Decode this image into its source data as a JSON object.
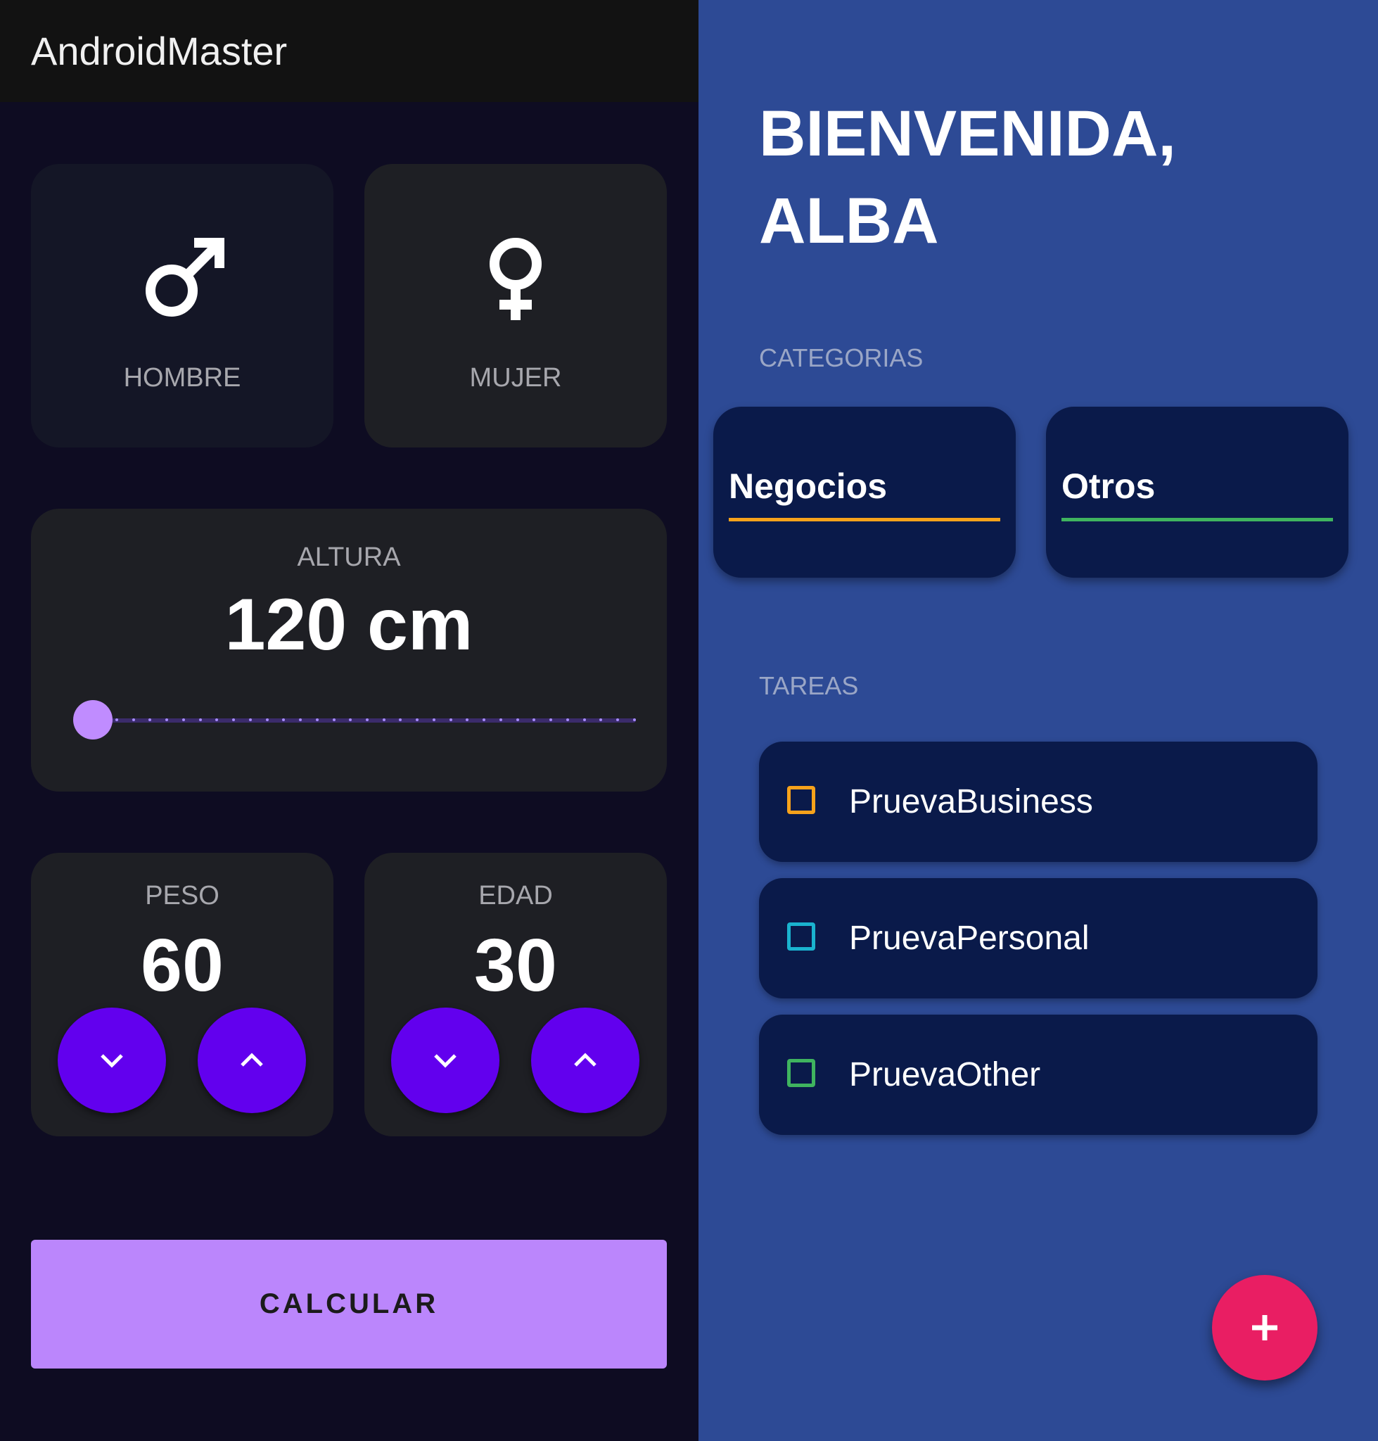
{
  "left_app": {
    "title": "AndroidMaster",
    "gender": {
      "male": {
        "label": "HOMBRE",
        "icon": "male-symbol-icon"
      },
      "female": {
        "label": "MUJER",
        "icon": "female-symbol-icon"
      }
    },
    "height": {
      "label": "ALTURA",
      "value": "120 cm"
    },
    "weight": {
      "label": "PESO",
      "value": "60"
    },
    "age": {
      "label": "EDAD",
      "value": "30"
    },
    "calculate_label": "CALCULAR",
    "colors": {
      "accent": "#6200ee",
      "button": "#bb86fc",
      "card": "#1e1f24"
    }
  },
  "right_app": {
    "greeting_line1": "BIENVENIDA,",
    "greeting_line2": "ALBA",
    "categories_label": "CATEGORIAS",
    "categories": [
      {
        "name": "Negocios",
        "color": "#f7a21b"
      },
      {
        "name": "Otros",
        "color": "#3fb45f"
      }
    ],
    "tasks_label": "TAREAS",
    "tasks": [
      {
        "name": "PruevaBusiness",
        "checked": false,
        "color": "#f7a21b"
      },
      {
        "name": "PruevaPersonal",
        "checked": false,
        "color": "#1ab3cf"
      },
      {
        "name": "PruevaOther",
        "checked": false,
        "color": "#3fb45f"
      }
    ],
    "fab_icon": "plus-icon",
    "colors": {
      "background": "#2d4a95",
      "card": "#0a1a4a",
      "fab": "#e91e63"
    }
  }
}
